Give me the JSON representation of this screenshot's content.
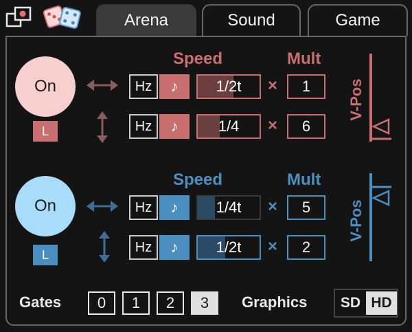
{
  "tabs": [
    "Arena",
    "Sound",
    "Game"
  ],
  "colors": {
    "red": "#c96f6f",
    "red_light": "#f8cfcf",
    "blue": "#4a8fc0",
    "blue_light": "#a9dcf8",
    "bg": "#141414"
  },
  "red": {
    "on_label": "On",
    "l_label": "L",
    "speed_header": "Speed",
    "mult_header": "Mult",
    "vpos_label": "V-Pos",
    "rows": [
      {
        "hz": "Hz",
        "note": "♪",
        "speed": "1/2t",
        "times": "×",
        "mult": "1"
      },
      {
        "hz": "Hz",
        "note": "♪",
        "speed": "1/4",
        "times": "×",
        "mult": "6"
      }
    ]
  },
  "blue": {
    "on_label": "On",
    "l_label": "L",
    "speed_header": "Speed",
    "mult_header": "Mult",
    "vpos_label": "V-Pos",
    "rows": [
      {
        "hz": "Hz",
        "note": "♪",
        "speed": "1/4t",
        "times": "×",
        "mult": "5"
      },
      {
        "hz": "Hz",
        "note": "♪",
        "speed": "1/2t",
        "times": "×",
        "mult": "2"
      }
    ]
  },
  "gates": {
    "label": "Gates",
    "options": [
      "0",
      "1",
      "2",
      "3"
    ]
  },
  "graphics": {
    "label": "Graphics",
    "sd": "SD",
    "hd": "HD"
  }
}
